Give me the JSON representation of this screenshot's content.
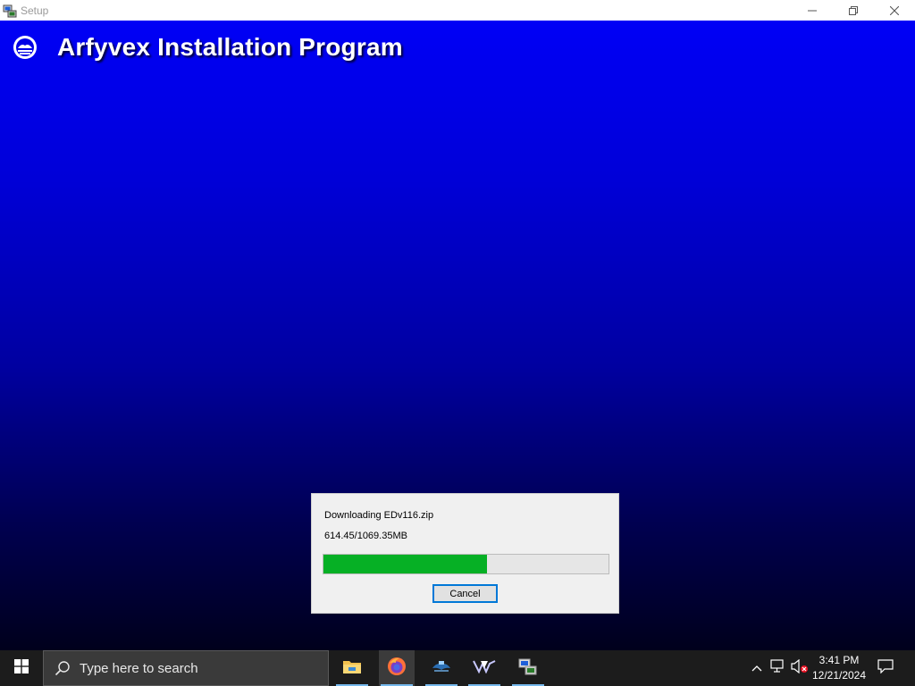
{
  "window": {
    "title": "Setup",
    "controls": {
      "minimize_icon": "minimize-icon",
      "restore_icon": "restore-icon",
      "close_icon": "close-icon"
    }
  },
  "header": {
    "title": "Arfyvex Installation Program",
    "logo_icon": "setup-logo-icon"
  },
  "progress_dialog": {
    "status_text": "Downloading EDv116.zip",
    "size_text": "614.45/1069.35MB",
    "progress_fraction": 0.5746,
    "cancel_label": "Cancel"
  },
  "taskbar": {
    "search_placeholder": "Type here to search",
    "pinned_apps": [
      {
        "name": "file-explorer-icon",
        "active": false,
        "underline": true
      },
      {
        "name": "firefox-icon",
        "active": true,
        "underline": true
      },
      {
        "name": "game-app-icon",
        "active": false,
        "underline": true
      },
      {
        "name": "media-app-icon",
        "active": false,
        "underline": true
      },
      {
        "name": "setup-app-icon",
        "active": false,
        "underline": true
      }
    ],
    "clock": {
      "time": "3:41 PM",
      "date": "12/21/2024"
    }
  },
  "colors": {
    "background_top": "#0000f6",
    "background_bottom": "#00001c",
    "progress_fill": "#06b025",
    "button_focus": "#0078d7",
    "taskbar": "#1c1c1c"
  }
}
